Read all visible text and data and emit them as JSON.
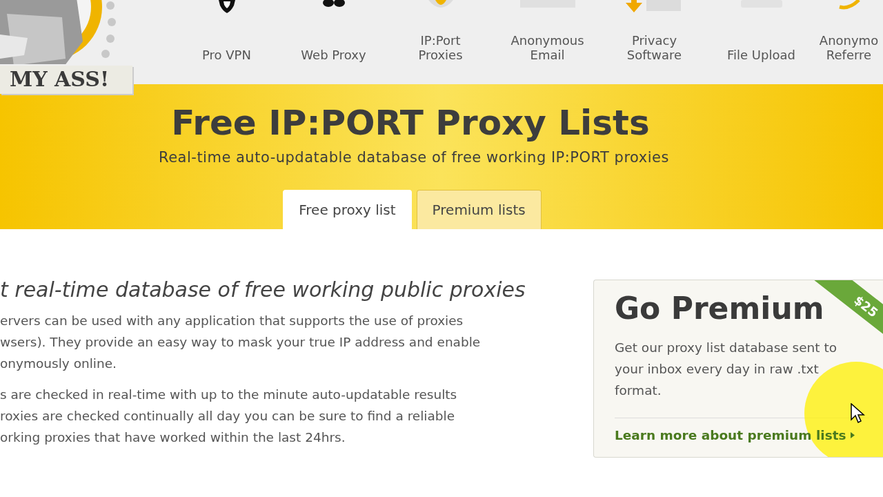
{
  "logo": {
    "text": "MY ASS!"
  },
  "nav": [
    {
      "label": "Pro VPN"
    },
    {
      "label": "Web Proxy"
    },
    {
      "label": "IP:Port Proxies"
    },
    {
      "label": "Anonymous Email"
    },
    {
      "label": "Privacy Software"
    },
    {
      "label": "File Upload"
    },
    {
      "label": "Anonymo Referre"
    }
  ],
  "hero": {
    "title": "Free IP:PORT Proxy Lists",
    "subtitle": "Real-time auto-updatable database of free working IP:PORT proxies"
  },
  "tabs": [
    {
      "label": "Free proxy list",
      "selected": true
    },
    {
      "label": "Premium lists",
      "selected": false
    }
  ],
  "article": {
    "heading": "t real-time database of  free working public proxies",
    "paragraphs": [
      [
        "ervers can be used with any application that supports the use of proxies",
        "wsers). They provide an easy way to mask your true IP address and enable",
        "onymously online."
      ],
      [
        "s are checked in real-time with up to the minute auto-updatable results",
        "roxies are checked continually all day you can be sure to find a reliable",
        "orking proxies that have worked within the last 24hrs."
      ]
    ]
  },
  "premium": {
    "title": "Go Premium",
    "ribbon": "$25",
    "text": "Get our proxy list database sent to your inbox every day in raw .txt format.",
    "link": "Learn more about premium lists"
  }
}
